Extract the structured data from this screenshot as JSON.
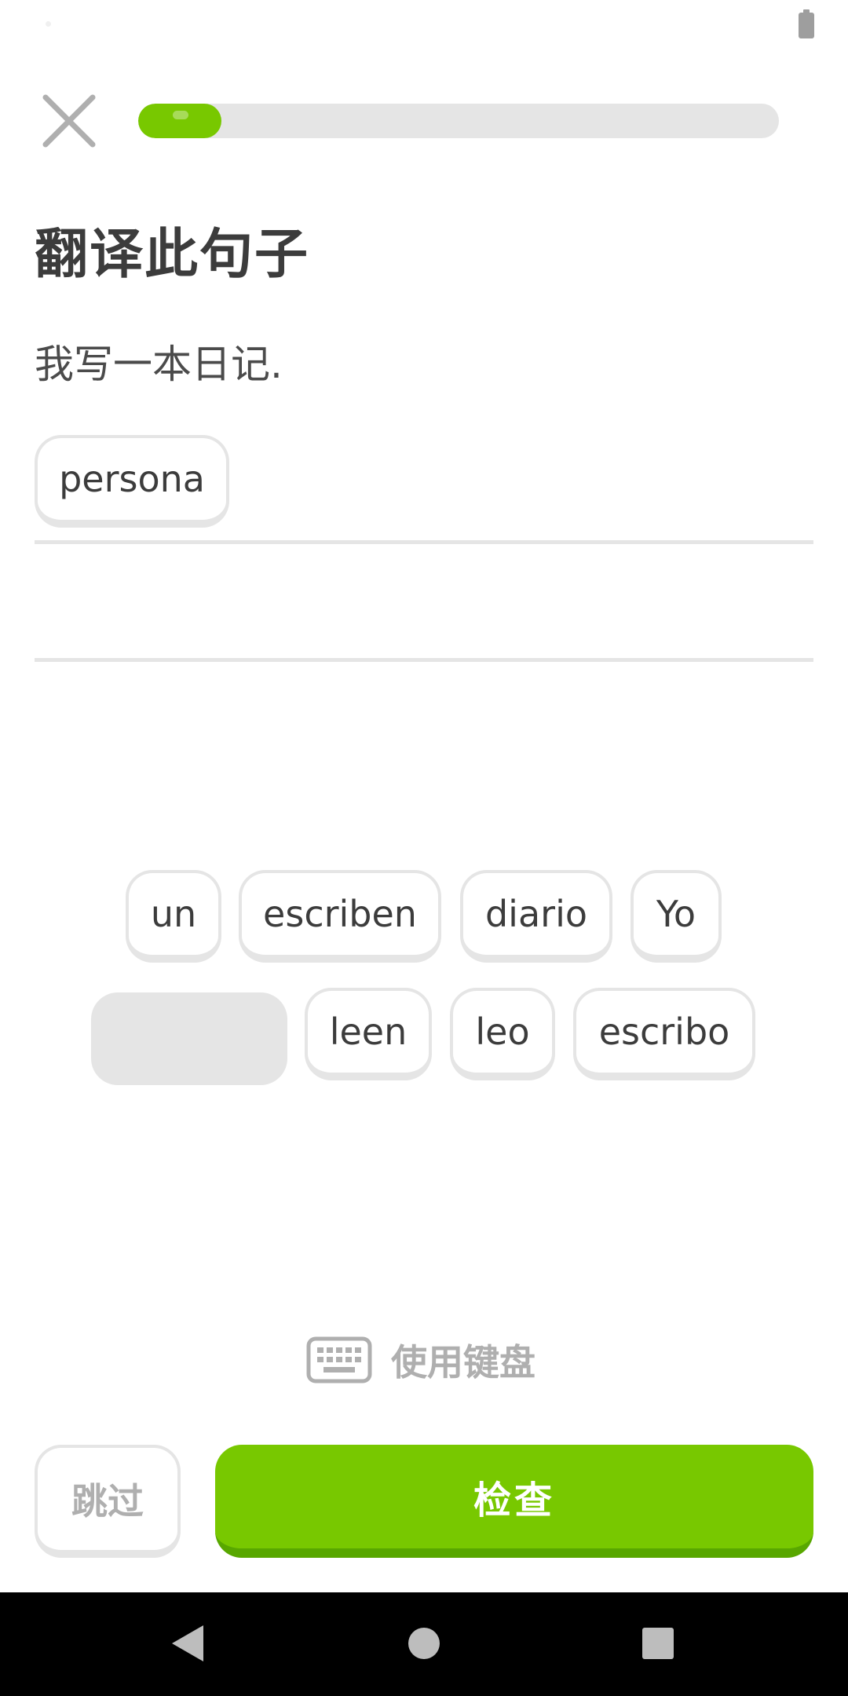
{
  "lesson": {
    "progress": 0.13,
    "title": "翻译此句子",
    "prompt": "我写一本日记."
  },
  "answer_tiles": [
    {
      "word": "persona"
    }
  ],
  "word_bank": {
    "row1": [
      {
        "word": "un"
      },
      {
        "word": "escriben"
      },
      {
        "word": "diario"
      },
      {
        "word": "Yo"
      }
    ],
    "row2": [
      {
        "word": "leen"
      },
      {
        "word": "leo"
      },
      {
        "word": "escribo"
      }
    ]
  },
  "keyboard_toggle": {
    "label": "使用键盘",
    "icon": "keyboard-icon"
  },
  "buttons": {
    "skip": "跳过",
    "check": "检查"
  },
  "colors": {
    "accent": "#78c800",
    "accent_dark": "#58a700",
    "border": "#e5e5e5",
    "muted_text": "#afafaf",
    "title_text": "#3c3c3c"
  },
  "icons": {
    "close": "close-icon",
    "battery": "battery-icon",
    "nav_back": "back-triangle-icon",
    "nav_home": "home-circle-icon",
    "nav_recents": "recents-square-icon"
  }
}
